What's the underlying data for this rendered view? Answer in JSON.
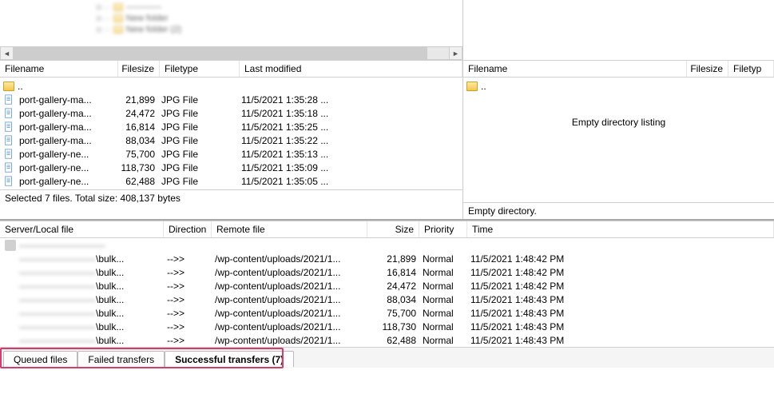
{
  "tree": {
    "items": [
      "————",
      "New folder",
      "New folder (2)"
    ]
  },
  "localList": {
    "headers": {
      "filename": "Filename",
      "filesize": "Filesize",
      "filetype": "Filetype",
      "lastmodified": "Last modified"
    },
    "parent": "..",
    "rows": [
      {
        "name": "port-gallery-ma...",
        "size": "21,899",
        "type": "JPG File",
        "modified": "11/5/2021 1:35:28 ..."
      },
      {
        "name": "port-gallery-ma...",
        "size": "24,472",
        "type": "JPG File",
        "modified": "11/5/2021 1:35:18 ..."
      },
      {
        "name": "port-gallery-ma...",
        "size": "16,814",
        "type": "JPG File",
        "modified": "11/5/2021 1:35:25 ..."
      },
      {
        "name": "port-gallery-ma...",
        "size": "88,034",
        "type": "JPG File",
        "modified": "11/5/2021 1:35:22 ..."
      },
      {
        "name": "port-gallery-ne...",
        "size": "75,700",
        "type": "JPG File",
        "modified": "11/5/2021 1:35:13 ..."
      },
      {
        "name": "port-gallery-ne...",
        "size": "118,730",
        "type": "JPG File",
        "modified": "11/5/2021 1:35:09 ..."
      },
      {
        "name": "port-gallery-ne...",
        "size": "62,488",
        "type": "JPG File",
        "modified": "11/5/2021 1:35:05 ..."
      }
    ],
    "status": "Selected 7 files. Total size: 408,137 bytes"
  },
  "remoteList": {
    "headers": {
      "filename": "Filename",
      "filesize": "Filesize",
      "filetype": "Filetyp"
    },
    "parent": "..",
    "empty": "Empty directory listing",
    "status": "Empty directory."
  },
  "queue": {
    "headers": {
      "server": "Server/Local file",
      "direction": "Direction",
      "remote": "Remote file",
      "size": "Size",
      "priority": "Priority",
      "time": "Time"
    },
    "serverRow": "—————————",
    "rows": [
      {
        "local": "\\bulk...",
        "dir": "-->>",
        "remote": "/wp-content/uploads/2021/1...",
        "size": "21,899",
        "priority": "Normal",
        "time": "11/5/2021 1:48:42 PM"
      },
      {
        "local": "\\bulk...",
        "dir": "-->>",
        "remote": "/wp-content/uploads/2021/1...",
        "size": "16,814",
        "priority": "Normal",
        "time": "11/5/2021 1:48:42 PM"
      },
      {
        "local": "\\bulk...",
        "dir": "-->>",
        "remote": "/wp-content/uploads/2021/1...",
        "size": "24,472",
        "priority": "Normal",
        "time": "11/5/2021 1:48:42 PM"
      },
      {
        "local": "\\bulk...",
        "dir": "-->>",
        "remote": "/wp-content/uploads/2021/1...",
        "size": "88,034",
        "priority": "Normal",
        "time": "11/5/2021 1:48:43 PM"
      },
      {
        "local": "\\bulk...",
        "dir": "-->>",
        "remote": "/wp-content/uploads/2021/1...",
        "size": "75,700",
        "priority": "Normal",
        "time": "11/5/2021 1:48:43 PM"
      },
      {
        "local": "\\bulk...",
        "dir": "-->>",
        "remote": "/wp-content/uploads/2021/1...",
        "size": "118,730",
        "priority": "Normal",
        "time": "11/5/2021 1:48:43 PM"
      },
      {
        "local": "\\bulk...",
        "dir": "-->>",
        "remote": "/wp-content/uploads/2021/1...",
        "size": "62,488",
        "priority": "Normal",
        "time": "11/5/2021 1:48:43 PM"
      }
    ]
  },
  "tabs": {
    "queued": "Queued files",
    "failed": "Failed transfers",
    "successful": "Successful transfers (7)"
  }
}
